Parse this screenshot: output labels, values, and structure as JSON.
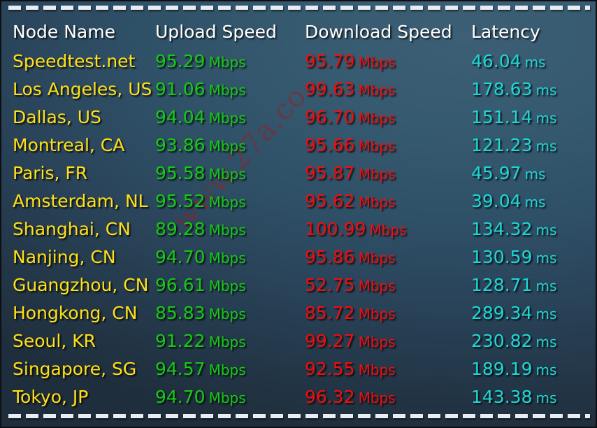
{
  "watermark": {
    "text": "www.27a.co"
  },
  "separator": {
    "style": "dashed"
  },
  "table": {
    "headers": {
      "node": "Node Name",
      "upload": "Upload Speed",
      "download": "Download Speed",
      "latency": "Latency"
    },
    "units": {
      "speed": "Mbps",
      "latency": "ms"
    },
    "colors": {
      "node": "#ffe019",
      "upload": "#16c916",
      "download": "#f20d0d",
      "latency": "#1fd6d6",
      "header": "#ffffff",
      "background": "#325469",
      "watermark": "#961e26"
    },
    "rows": [
      {
        "node": "Speedtest.net",
        "upload": "95.29",
        "upload_unit": "Mbps",
        "download": "95.79",
        "download_unit": "Mbps",
        "latency": "46.04",
        "latency_unit": "ms"
      },
      {
        "node": "Los Angeles, US",
        "upload": "91.06",
        "upload_unit": "Mbps",
        "download": "99.63",
        "download_unit": "Mbps",
        "latency": "178.63",
        "latency_unit": "ms"
      },
      {
        "node": "Dallas, US",
        "upload": "94.04",
        "upload_unit": "Mbps",
        "download": "96.70",
        "download_unit": "Mbps",
        "latency": "151.14",
        "latency_unit": "ms"
      },
      {
        "node": "Montreal, CA",
        "upload": "93.86",
        "upload_unit": "Mbps",
        "download": "95.66",
        "download_unit": "Mbps",
        "latency": "121.23",
        "latency_unit": "ms"
      },
      {
        "node": "Paris, FR",
        "upload": "95.58",
        "upload_unit": "Mbps",
        "download": "95.87",
        "download_unit": "Mbps",
        "latency": "45.97",
        "latency_unit": "ms"
      },
      {
        "node": "Amsterdam, NL",
        "upload": "95.52",
        "upload_unit": "Mbps",
        "download": "95.62",
        "download_unit": "Mbps",
        "latency": "39.04",
        "latency_unit": "ms"
      },
      {
        "node": "Shanghai, CN",
        "upload": "89.28",
        "upload_unit": "Mbps",
        "download": "100.99",
        "download_unit": "Mbps",
        "latency": "134.32",
        "latency_unit": "ms"
      },
      {
        "node": "Nanjing, CN",
        "upload": "94.70",
        "upload_unit": "Mbps",
        "download": "95.86",
        "download_unit": "Mbps",
        "latency": "130.59",
        "latency_unit": "ms"
      },
      {
        "node": "Guangzhou, CN",
        "upload": "96.61",
        "upload_unit": "Mbps",
        "download": "52.75",
        "download_unit": "Mbps",
        "latency": "128.71",
        "latency_unit": "ms"
      },
      {
        "node": "Hongkong, CN",
        "upload": "85.83",
        "upload_unit": "Mbps",
        "download": "85.72",
        "download_unit": "Mbps",
        "latency": "289.34",
        "latency_unit": "ms"
      },
      {
        "node": "Seoul, KR",
        "upload": "91.22",
        "upload_unit": "Mbps",
        "download": "99.27",
        "download_unit": "Mbps",
        "latency": "230.82",
        "latency_unit": "ms"
      },
      {
        "node": "Singapore, SG",
        "upload": "94.57",
        "upload_unit": "Mbps",
        "download": "92.55",
        "download_unit": "Mbps",
        "latency": "189.19",
        "latency_unit": "ms"
      },
      {
        "node": "Tokyo, JP",
        "upload": "94.70",
        "upload_unit": "Mbps",
        "download": "96.32",
        "download_unit": "Mbps",
        "latency": "143.38",
        "latency_unit": "ms"
      }
    ]
  }
}
